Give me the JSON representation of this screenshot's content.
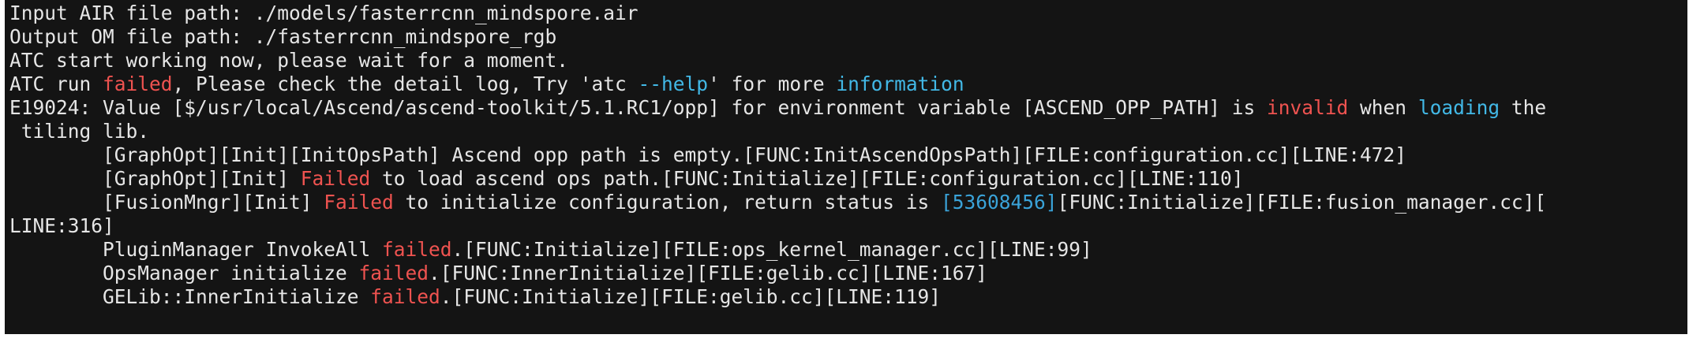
{
  "colors": {
    "background": "#141414",
    "default_text": "#e6e6e6",
    "error_red": "#ef5350",
    "keyword_cyan": "#42b8e6",
    "number_blue": "#3aa3d9"
  },
  "terminal": {
    "lines": [
      {
        "segments": [
          {
            "text": "Input AIR file path: ./models/fasterrcnn_mindspore.air",
            "style": "default"
          }
        ]
      },
      {
        "segments": [
          {
            "text": "Output OM file path: ./fasterrcnn_mindspore_rgb",
            "style": "default"
          }
        ]
      },
      {
        "segments": [
          {
            "text": "ATC start working now, please wait for a moment.",
            "style": "default"
          }
        ]
      },
      {
        "segments": [
          {
            "text": "ATC run ",
            "style": "default"
          },
          {
            "text": "failed",
            "style": "red"
          },
          {
            "text": ", Please check the detail log, Try 'atc ",
            "style": "default"
          },
          {
            "text": "--help",
            "style": "cyan"
          },
          {
            "text": "' for more ",
            "style": "default"
          },
          {
            "text": "information",
            "style": "cyan"
          }
        ]
      },
      {
        "segments": [
          {
            "text": "E19024: Value [$/usr/local/Ascend/ascend-toolkit/5.1.RC1/opp] for environment variable [ASCEND_OPP_PATH] is ",
            "style": "default"
          },
          {
            "text": "invalid",
            "style": "red"
          },
          {
            "text": " when ",
            "style": "default"
          },
          {
            "text": "loading",
            "style": "cyan"
          },
          {
            "text": " the",
            "style": "default"
          }
        ]
      },
      {
        "segments": [
          {
            "text": " tiling lib.",
            "style": "default"
          }
        ]
      },
      {
        "segments": [
          {
            "text": "        [GraphOpt][Init][InitOpsPath] Ascend opp path is empty.[FUNC:InitAscendOpsPath][FILE:configuration.cc][LINE:472]",
            "style": "default"
          }
        ]
      },
      {
        "segments": [
          {
            "text": "        [GraphOpt][Init] ",
            "style": "default"
          },
          {
            "text": "Failed",
            "style": "red"
          },
          {
            "text": " to load ascend ops path.[FUNC:Initialize][FILE:configuration.cc][LINE:110]",
            "style": "default"
          }
        ]
      },
      {
        "segments": [
          {
            "text": "        [FusionMngr][Init] ",
            "style": "default"
          },
          {
            "text": "Failed",
            "style": "red"
          },
          {
            "text": " to initialize configuration, return status is ",
            "style": "default"
          },
          {
            "text": "[53608456]",
            "style": "blue"
          },
          {
            "text": "[FUNC:Initialize][FILE:fusion_manager.cc][",
            "style": "default"
          }
        ]
      },
      {
        "segments": [
          {
            "text": "LINE:316]",
            "style": "default"
          }
        ]
      },
      {
        "segments": [
          {
            "text": "        PluginManager InvokeAll ",
            "style": "default"
          },
          {
            "text": "failed",
            "style": "red"
          },
          {
            "text": ".[FUNC:Initialize][FILE:ops_kernel_manager.cc][LINE:99]",
            "style": "default"
          }
        ]
      },
      {
        "segments": [
          {
            "text": "        OpsManager initialize ",
            "style": "default"
          },
          {
            "text": "failed",
            "style": "red"
          },
          {
            "text": ".[FUNC:InnerInitialize][FILE:gelib.cc][LINE:167]",
            "style": "default"
          }
        ]
      },
      {
        "segments": [
          {
            "text": "        GELib::InnerInitialize ",
            "style": "default"
          },
          {
            "text": "failed",
            "style": "red"
          },
          {
            "text": ".[FUNC:Initialize][FILE:gelib.cc][LINE:119]",
            "style": "default"
          }
        ]
      }
    ]
  }
}
